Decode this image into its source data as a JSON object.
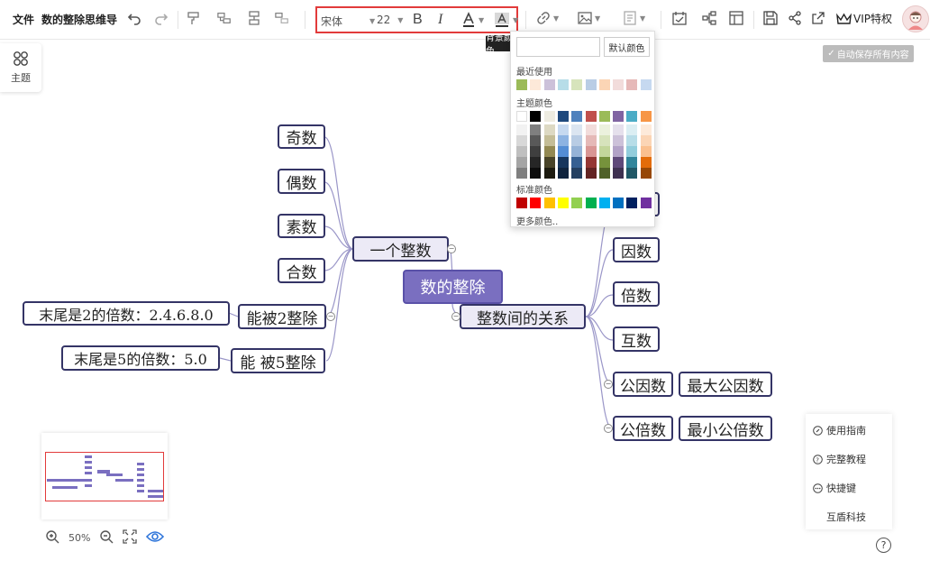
{
  "toolbar": {
    "file_label": "文件",
    "doc_title": "数的整除思维导",
    "font_family": "宋体",
    "font_size": "22",
    "vip_label": "VIP特权",
    "tooltip": "背景颜色"
  },
  "sidebar": {
    "theme_label": "主题"
  },
  "status": {
    "autosave": "自动保存所有内容"
  },
  "mindmap": {
    "root": "数的整除",
    "branches": {
      "one_number": "一个整数",
      "relation": "整数间的关系"
    },
    "left_children": [
      "奇数",
      "偶数",
      "素数",
      "合数",
      "能被2整除",
      "能 被5整除"
    ],
    "left_notes": [
      "末尾是2的倍数：2.4.6.8.0",
      "末尾是5的倍数：5.0"
    ],
    "right_children": [
      "因数",
      "倍数",
      "互数",
      "公因数",
      "公倍数"
    ],
    "right_notes": [
      "最大公因数",
      "最小公倍数"
    ]
  },
  "color_picker": {
    "default_label": "默认颜色",
    "recent_label": "最近使用",
    "theme_label": "主题颜色",
    "standard_label": "标准颜色",
    "more_label": "更多颜色..",
    "recent_colors": [
      "#9bbb59",
      "#fde9d9",
      "#ccc1d9",
      "#b7dde8",
      "#d7e4bc",
      "#b9cde5",
      "#fbd5b5",
      "#f2dcdb",
      "#e6b9b8",
      "#c6d9f0"
    ],
    "theme_top": [
      "#ffffff",
      "#000000",
      "#eeece1",
      "#1f497d",
      "#4f81bd",
      "#c0504d",
      "#9bbb59",
      "#8064a2",
      "#4bacc6",
      "#f79646"
    ],
    "theme_rows": [
      [
        "#f2f2f2",
        "#7f7f7f",
        "#ddd9c3",
        "#c6d9f0",
        "#dbe5f1",
        "#f2dcdb",
        "#ebf1dd",
        "#e5e0ec",
        "#dbeef3",
        "#fdeada"
      ],
      [
        "#d8d8d8",
        "#595959",
        "#c4bd97",
        "#8db3e2",
        "#b8cce4",
        "#e5b9b7",
        "#d7e3bc",
        "#ccc1d9",
        "#b7dde8",
        "#fbd5b5"
      ],
      [
        "#bfbfbf",
        "#3f3f3f",
        "#938953",
        "#548dd4",
        "#95b3d7",
        "#d99694",
        "#c3d69b",
        "#b2a2c7",
        "#92cddc",
        "#fac08f"
      ],
      [
        "#a5a5a5",
        "#262626",
        "#494429",
        "#17365d",
        "#366092",
        "#953734",
        "#76923c",
        "#5f497a",
        "#31859b",
        "#e36c09"
      ],
      [
        "#7f7f7f",
        "#0c0c0c",
        "#1d1b10",
        "#0f243e",
        "#244061",
        "#632423",
        "#4f6128",
        "#3f3151",
        "#205867",
        "#974806"
      ]
    ],
    "standard": [
      "#c00000",
      "#ff0000",
      "#ffc000",
      "#ffff00",
      "#92d050",
      "#00b050",
      "#00b0f0",
      "#0070c0",
      "#002060",
      "#7030a0"
    ]
  },
  "minimap": {
    "zoom": "50%"
  },
  "help": {
    "guide": "使用指南",
    "tutorial": "完整教程",
    "shortcuts": "快捷键",
    "company": "互盾科技"
  }
}
